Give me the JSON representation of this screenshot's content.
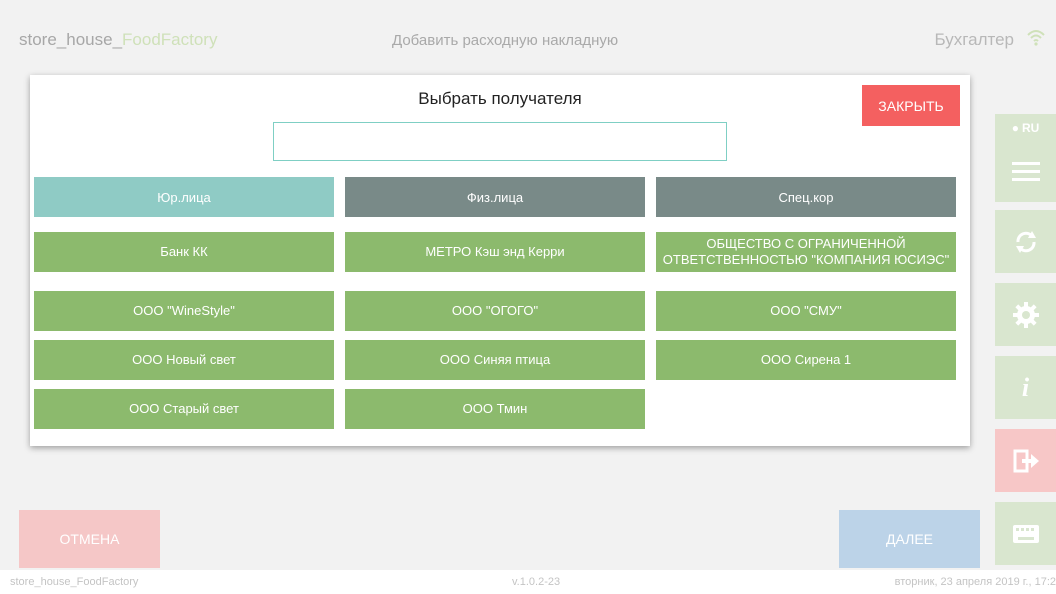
{
  "header": {
    "app_name_main": "store_house_",
    "app_name_accent": "FoodFactory",
    "page_heading": "Добавить расходную накладную",
    "user": "Бухгалтер"
  },
  "side_menu": {
    "lang": "RU",
    "items": [
      "menu-icon",
      "sync-icon",
      "gear-icon",
      "info-icon",
      "exit-icon",
      "keyboard-icon"
    ]
  },
  "actions": {
    "cancel": "ОТМЕНА",
    "next": "ДАЛЕЕ"
  },
  "footer": {
    "left": "store_house_FoodFactory",
    "version": "v.1.0.2-23",
    "datetime": "вторник, 23 апреля 2019 г., 17:2"
  },
  "modal": {
    "title": "Выбрать получателя",
    "close": "ЗАКРЫТЬ",
    "search_value": "",
    "tabs": [
      {
        "label": "Юр.лица",
        "active": true
      },
      {
        "label": "Физ.лица",
        "active": false
      },
      {
        "label": "Спец.кор",
        "active": false
      }
    ],
    "recipients": [
      "Банк КК",
      "МЕТРО Кэш энд Керри",
      "ОБЩЕСТВО С ОГРАНИЧЕННОЙ ОТВЕТСТВЕННОСТЬЮ \"КОМПАНИЯ ЮСИЭС\"",
      "ООО \"WineStyle\"",
      "ООО \"ОГОГО\"",
      "ООО \"СМУ\"",
      "ООО Новый свет",
      "ООО Синяя птица",
      "ООО Сирена 1",
      "ООО Старый свет",
      "ООО Тмин"
    ]
  },
  "colors": {
    "active_tab": "#8fcbc5",
    "inactive_tab": "#798a88",
    "recipient": "#8cba6d",
    "close": "#f46060"
  }
}
